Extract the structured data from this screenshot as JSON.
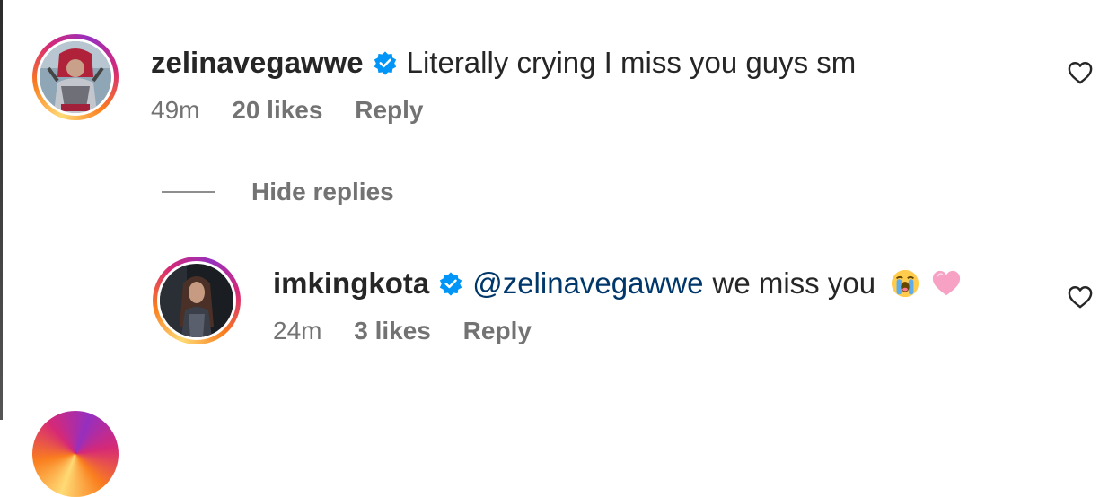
{
  "comments": [
    {
      "username": "zelinavegawwe",
      "text": "Literally crying I miss you guys sm",
      "time": "49m",
      "likes": "20 likes",
      "reply_label": "Reply"
    }
  ],
  "hide_replies_label": "Hide replies",
  "replies": [
    {
      "username": "imkingkota",
      "mention": "@zelinavegawwe",
      "text": "we miss you",
      "emojis": [
        "loudly-crying-face",
        "pink-heart"
      ],
      "time": "24m",
      "likes": "3 likes",
      "reply_label": "Reply"
    }
  ],
  "colors": {
    "text": "#262626",
    "muted": "#737373",
    "mention": "#00376b",
    "verified": "#0095f6"
  }
}
